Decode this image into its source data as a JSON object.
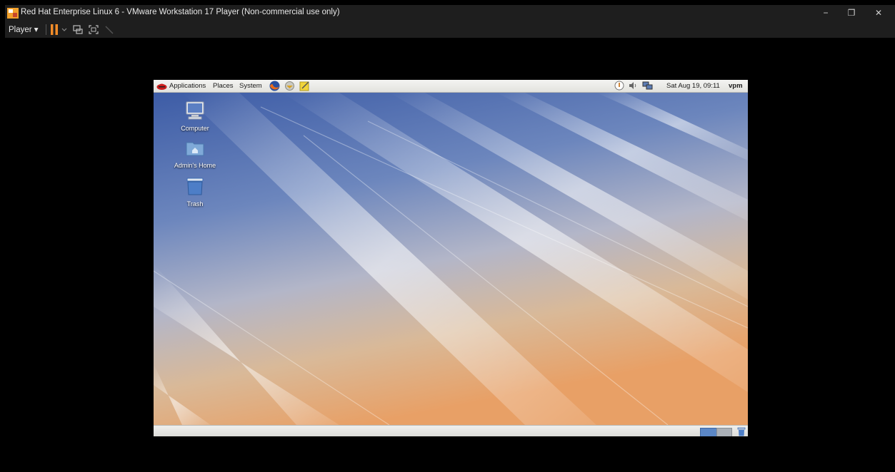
{
  "window": {
    "title": "Red Hat Enterprise Linux 6 - VMware Workstation 17 Player (Non-commercial use only)",
    "controls": {
      "minimize": "−",
      "restore": "❐",
      "close": "✕"
    }
  },
  "toolbar": {
    "player_label": "Player ▾",
    "icons": [
      "pause-icon",
      "dropdown-icon",
      "send-ctrl-alt-del-icon",
      "fullscreen-icon",
      "unity-icon"
    ]
  },
  "guest": {
    "top_panel": {
      "menus": [
        "Applications",
        "Places",
        "System"
      ],
      "clock": "Sat Aug 19, 09:11",
      "user": "vpm"
    },
    "desktop_icons": [
      {
        "label": "Computer",
        "icon": "computer-icon"
      },
      {
        "label": "Admin's Home",
        "icon": "home-folder-icon"
      },
      {
        "label": "Trash",
        "icon": "trash-icon"
      }
    ]
  },
  "colors": {
    "chrome": "#1e1e1e",
    "pause": "#f28c28",
    "wallpaper_top": "#3f5ea6",
    "wallpaper_bottom": "#e6a36c"
  }
}
